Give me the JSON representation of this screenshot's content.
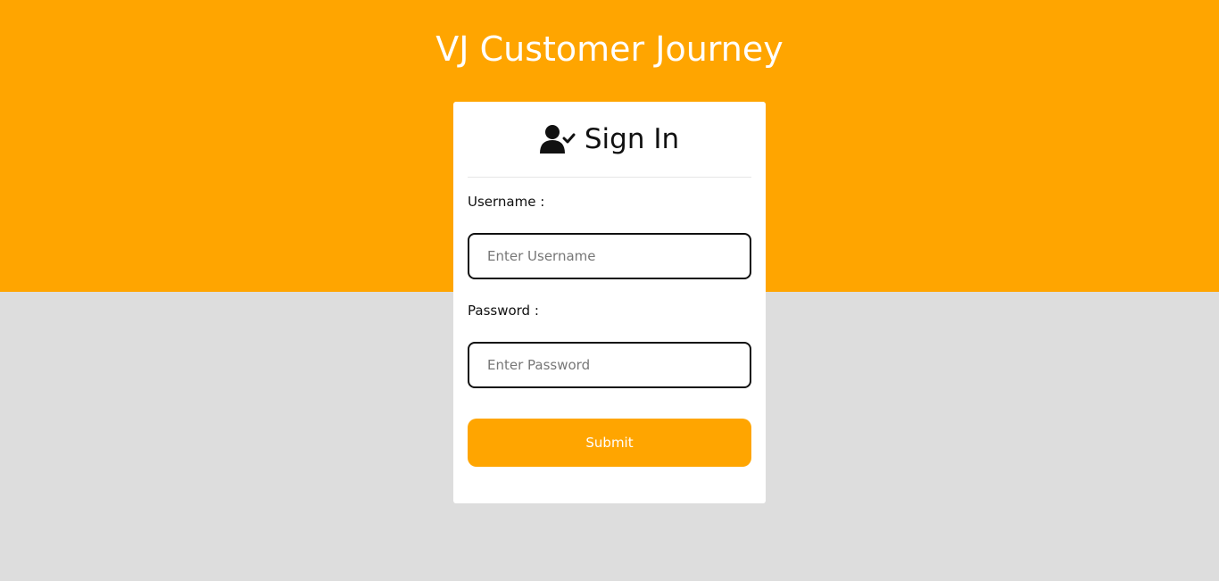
{
  "header": {
    "title": "VJ Customer Journey"
  },
  "login_card": {
    "title": "Sign In",
    "icon": "user-check-icon",
    "username": {
      "label": "Username :",
      "placeholder": "Enter Username",
      "value": ""
    },
    "password": {
      "label": "Password :",
      "placeholder": "Enter Password",
      "value": ""
    },
    "submit_label": "Submit"
  },
  "colors": {
    "accent": "#ffa500",
    "background": "#dddddd",
    "card": "#ffffff"
  }
}
